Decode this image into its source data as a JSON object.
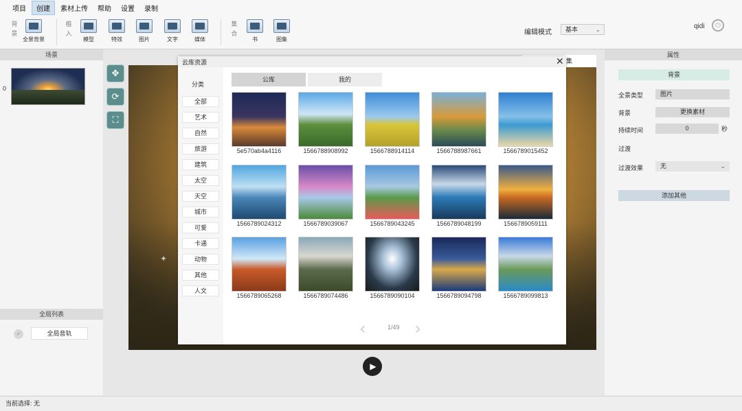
{
  "menubar": {
    "items": [
      "项目",
      "创建",
      "素材上传",
      "帮助",
      "设置",
      "录制"
    ],
    "active": "创建"
  },
  "toolbar": {
    "group_bg_label": "背景",
    "panorama_bg": "全景背景",
    "group_insert_label": "植入",
    "model": "模型",
    "effect": "特效",
    "image": "图片",
    "text": "文字",
    "media": "媒体",
    "group_collection_label": "集合",
    "book": "书",
    "album": "图集",
    "edit_mode_label": "编辑模式",
    "edit_mode_value": "基本",
    "username": "qidi"
  },
  "left_panel": {
    "scene_header": "场景",
    "scene_index": "0",
    "global_list_header": "全局列表",
    "global_track_button": "全局音轨"
  },
  "right_panel": {
    "header": "属性",
    "background_section": "背景",
    "pano_type_label": "全景类型",
    "pano_type_value": "图片",
    "background_label": "背景",
    "replace_material": "更换素材",
    "duration_label": "持续时间",
    "duration_value": "0",
    "duration_unit": "秒",
    "transition_label": "过渡",
    "transition_effect_label": "过渡效果",
    "transition_effect_value": "无",
    "add_other": "添加其他"
  },
  "canvas": {
    "bg_tag_text": "集"
  },
  "dialog": {
    "title": "云库资源",
    "category_header": "分类",
    "categories": [
      "全部",
      "艺术",
      "自然",
      "旅游",
      "建筑",
      "太空",
      "天空",
      "城市",
      "可爱",
      "卡通",
      "动物",
      "其他",
      "人文"
    ],
    "tabs": [
      "公库",
      "我的"
    ],
    "thumbnails": [
      {
        "name": "5e570ab4a4116"
      },
      {
        "name": "1566788908992"
      },
      {
        "name": "1566788914114"
      },
      {
        "name": "1566788987661"
      },
      {
        "name": "1566789015452"
      },
      {
        "name": "1566789024312"
      },
      {
        "name": "1566789039067"
      },
      {
        "name": "1566789043245"
      },
      {
        "name": "1566789048199"
      },
      {
        "name": "1566789059111"
      },
      {
        "name": "1566789065268"
      },
      {
        "name": "1566789074486"
      },
      {
        "name": "1566789090104"
      },
      {
        "name": "1566789094798"
      },
      {
        "name": "1566789099813"
      }
    ],
    "pager": "1/49"
  },
  "statusbar": {
    "label": "当前选择:",
    "value": "无"
  }
}
